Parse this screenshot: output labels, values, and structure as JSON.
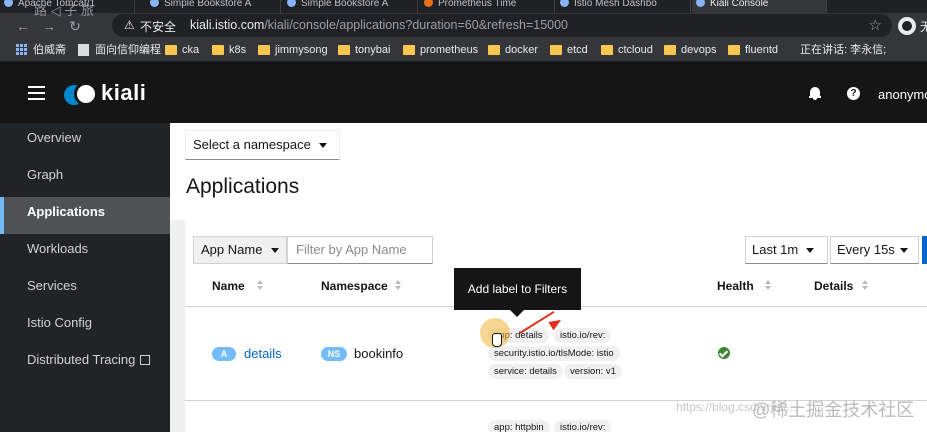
{
  "browser": {
    "tabs": [
      {
        "title": "Apache Tomcat/1"
      },
      {
        "title": "Simple Bookstore A"
      },
      {
        "title": "Simple Bookstore A"
      },
      {
        "title": "Prometheus Time"
      },
      {
        "title": "Istio Mesh Dashbo"
      },
      {
        "title": "Kiali Console"
      }
    ],
    "overlay_text": "路 ◁ 子 旅",
    "security_label": "不安全",
    "url_host": "kiali.istio.com",
    "url_path": "/kiali/console/applications?duration=60&refresh=15000",
    "profile_text": "无"
  },
  "bookmarks": [
    {
      "label": "伯威斋",
      "icon": "page-icon"
    },
    {
      "label": "面向信仰编程",
      "icon": "page-icon"
    },
    {
      "label": "cka",
      "icon": "folder-icon"
    },
    {
      "label": "k8s",
      "icon": "folder-icon"
    },
    {
      "label": "jimmysong",
      "icon": "folder-icon"
    },
    {
      "label": "tonybai",
      "icon": "folder-icon"
    },
    {
      "label": "prometheus",
      "icon": "folder-icon"
    },
    {
      "label": "docker",
      "icon": "folder-icon"
    },
    {
      "label": "etcd",
      "icon": "folder-icon"
    },
    {
      "label": "ctcloud",
      "icon": "folder-icon"
    },
    {
      "label": "devops",
      "icon": "folder-icon"
    },
    {
      "label": "fluentd",
      "icon": "folder-icon"
    },
    {
      "label": "正在讲话: 李永信;",
      "icon": ""
    }
  ],
  "masthead": {
    "logo_text": "kiali",
    "help_glyph": "?",
    "user": "anonymous"
  },
  "sidebar": {
    "items": [
      {
        "label": "Overview"
      },
      {
        "label": "Graph"
      },
      {
        "label": "Applications",
        "active": true
      },
      {
        "label": "Workloads"
      },
      {
        "label": "Services"
      },
      {
        "label": "Istio Config"
      },
      {
        "label": "Distributed Tracing"
      }
    ]
  },
  "main": {
    "namespace_select": "Select a namespace",
    "title": "Applications",
    "filter_type": "App Name",
    "filter_placeholder": "Filter by App Name",
    "duration_select": "Last 1m",
    "refresh_select": "Every 15s",
    "columns": [
      "Name",
      "Namespace",
      "Health",
      "Details"
    ],
    "tooltip": "Add label to Filters",
    "rows": [
      {
        "badge": "A",
        "name": "details",
        "ns_badge": "NS",
        "namespace": "bookinfo",
        "labels": [
          "app: details",
          "istio.io/rev:",
          "security.istio.io/tlsMode: istio",
          "service: details",
          "version: v1"
        ],
        "health": "healthy"
      },
      {
        "labels": [
          "app: httpbin",
          "istio.io/rev:"
        ]
      }
    ]
  },
  "watermark": {
    "url": "https://blog.csdn.net/...",
    "brand": "@稀土掘金技术社区"
  },
  "colors": {
    "accent": "#0066cc",
    "badge": "#73bcf7",
    "healthy": "#3e8635",
    "sidebar_active_border": "#73bcf7",
    "annotation_arrow": "#e0301e"
  }
}
